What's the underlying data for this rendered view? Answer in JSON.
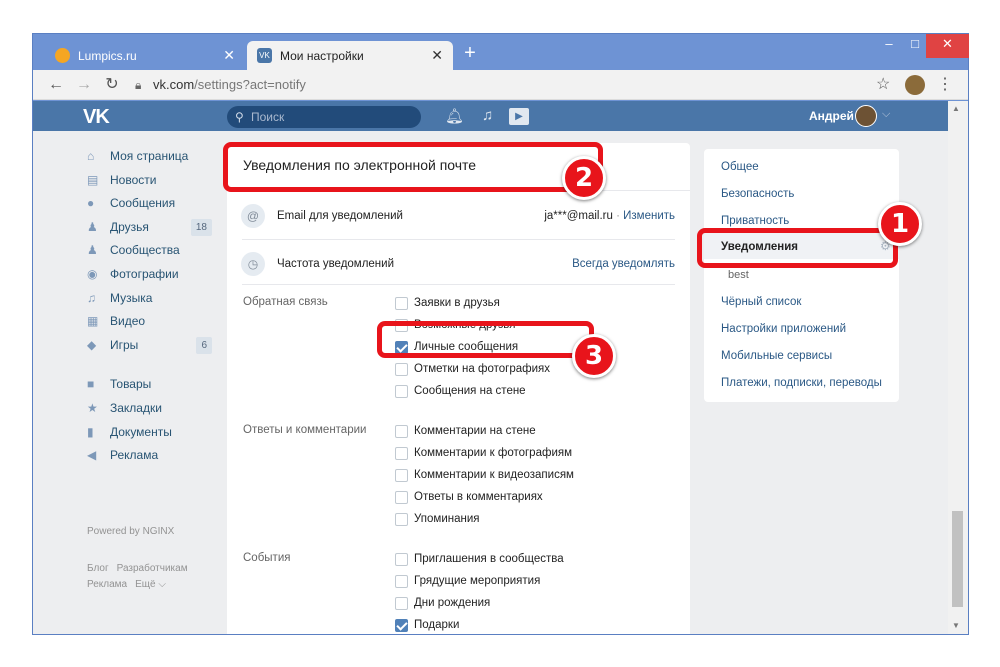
{
  "browser": {
    "tabs": [
      {
        "title": "Lumpics.ru",
        "active": false
      },
      {
        "title": "Мои настройки",
        "active": true
      }
    ],
    "new_tab": "+",
    "url_domain": "vk.com",
    "url_path": "/settings?act=notify",
    "window": {
      "min": "–",
      "max": "□",
      "close": "✕"
    }
  },
  "vk_header": {
    "logo": "VK",
    "search_placeholder": "Поиск",
    "user_name": "Андрей"
  },
  "left_nav": {
    "items": [
      {
        "label": "Моя страница",
        "icon": "home-icon",
        "glyph": "⌂",
        "count": ""
      },
      {
        "label": "Новости",
        "icon": "news-icon",
        "glyph": "▤",
        "count": ""
      },
      {
        "label": "Сообщения",
        "icon": "messages-icon",
        "glyph": "●",
        "count": ""
      },
      {
        "label": "Друзья",
        "icon": "friends-icon",
        "glyph": "♟",
        "count": "18"
      },
      {
        "label": "Сообщества",
        "icon": "communities-icon",
        "glyph": "♟",
        "count": ""
      },
      {
        "label": "Фотографии",
        "icon": "camera-icon",
        "glyph": "◉",
        "count": ""
      },
      {
        "label": "Музыка",
        "icon": "music-icon",
        "glyph": "♫",
        "count": ""
      },
      {
        "label": "Видео",
        "icon": "video-icon",
        "glyph": "▦",
        "count": ""
      },
      {
        "label": "Игры",
        "icon": "games-icon",
        "glyph": "◆",
        "count": "6"
      }
    ],
    "items2": [
      {
        "label": "Товары",
        "icon": "bag-icon",
        "glyph": "■"
      },
      {
        "label": "Закладки",
        "icon": "star-icon",
        "glyph": "★"
      },
      {
        "label": "Документы",
        "icon": "document-icon",
        "glyph": "▮"
      },
      {
        "label": "Реклама",
        "icon": "megaphone-icon",
        "glyph": "◀"
      }
    ],
    "powered": "Powered by NGINX",
    "footer": [
      "Блог",
      "Разработчикам",
      "Реклама",
      "Ещё ⌵"
    ]
  },
  "content": {
    "title": "Уведомления по электронной почте",
    "email_label": "Email для уведомлений",
    "email_value": "ja***@mail.ru",
    "email_sep": " · ",
    "email_change": "Изменить",
    "freq_label": "Частота уведомлений",
    "freq_value": "Всегда уведомлять",
    "groups": [
      {
        "label": "Обратная связь",
        "options": [
          {
            "label": "Заявки в друзья",
            "checked": false
          },
          {
            "label": "Возможные друзья",
            "checked": false
          },
          {
            "label": "Личные сообщения",
            "checked": true
          },
          {
            "label": "Отметки на фотографиях",
            "checked": false
          },
          {
            "label": "Сообщения на стене",
            "checked": false
          }
        ]
      },
      {
        "label": "Ответы и комментарии",
        "options": [
          {
            "label": "Комментарии на стене",
            "checked": false
          },
          {
            "label": "Комментарии к фотографиям",
            "checked": false
          },
          {
            "label": "Комментарии к видеозаписям",
            "checked": false
          },
          {
            "label": "Ответы в комментариях",
            "checked": false
          },
          {
            "label": "Упоминания",
            "checked": false
          }
        ]
      },
      {
        "label": "События",
        "options": [
          {
            "label": "Приглашения в сообщества",
            "checked": false
          },
          {
            "label": "Грядущие мероприятия",
            "checked": false
          },
          {
            "label": "Дни рождения",
            "checked": false
          },
          {
            "label": "Подарки",
            "checked": true
          }
        ]
      }
    ]
  },
  "right_menu": {
    "items": [
      "Общее",
      "Безопасность",
      "Приватность",
      "Уведомления",
      "best",
      "Чёрный список",
      "Настройки приложений",
      "Мобильные сервисы",
      "Платежи, подписки, переводы"
    ],
    "selected": "Уведомления"
  },
  "annotations": {
    "b1": "1",
    "b2": "2",
    "b3": "3",
    "color": "#e8141b"
  },
  "colors": {
    "vk_blue": "#4a76a8",
    "link": "#2a5885",
    "page_bg": "#edeef0"
  }
}
